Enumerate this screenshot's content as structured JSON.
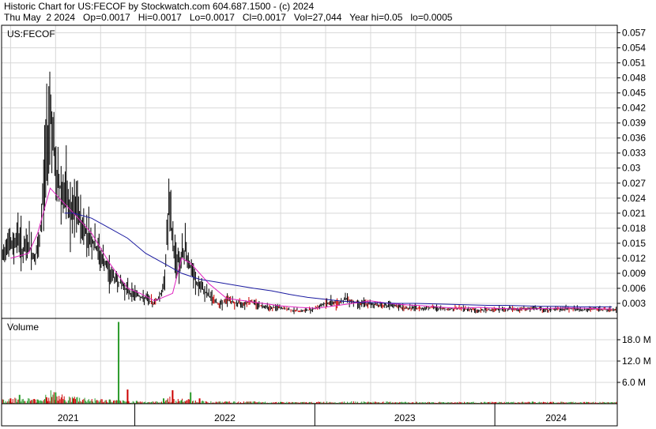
{
  "header": {
    "line1": "Historic Chart for US:FECOF by Stockwatch.com 604.687.1500 - (c) 2024",
    "line2": "Thu May  2 2024   Op=0.0017   Hi=0.0017   Lo=0.0017   Cl=0.0017   Vol=27,044   Year hi=0.05   lo=0.0005"
  },
  "colors": {
    "price": "#000000",
    "down_bar": "#cc0000",
    "ma_fast": "#e020c0",
    "ma_slow": "#1a1aa0",
    "volume_up": "#2a9a2a",
    "volume_down": "#cc0000",
    "grid": "#d8d8d8",
    "frame": "#000000"
  },
  "chart_data": [
    {
      "type": "line",
      "panel": "price",
      "title": "US:FECOF",
      "ylim": [
        0,
        0.0585
      ],
      "y_ticks": [
        "0.057",
        "0.054",
        "0.051",
        "0.048",
        "0.045",
        "0.042",
        "0.039",
        "0.036",
        "0.033",
        "0.03",
        "0.027",
        "0.024",
        "0.021",
        "0.018",
        "0.015",
        "0.012",
        "0.009",
        "0.006",
        "0.003"
      ],
      "x_labels": [
        "2021",
        "2022",
        "2023",
        "2024"
      ],
      "x_range": [
        2020.95,
        2024.37
      ],
      "x_boundaries": [
        2021.69,
        2022.69,
        2023.69
      ],
      "grid": true,
      "series": [
        {
          "role": "price",
          "x": [
            2020.95,
            2020.98,
            2021.01,
            2021.04,
            2021.07,
            2021.1,
            2021.13,
            2021.16,
            2021.19,
            2021.22,
            2021.25,
            2021.28,
            2021.31,
            2021.34,
            2021.37,
            2021.4,
            2021.43,
            2021.46,
            2021.49,
            2021.52,
            2021.55,
            2021.58,
            2021.61,
            2021.64,
            2021.67,
            2021.7,
            2021.73,
            2021.76,
            2021.79,
            2021.82,
            2021.85,
            2021.88,
            2021.91,
            2021.94,
            2021.97,
            2022.0,
            2022.03,
            2022.06,
            2022.09,
            2022.12,
            2022.15,
            2022.18,
            2022.21,
            2022.24,
            2022.27,
            2022.3,
            2022.33,
            2022.36,
            2022.39,
            2022.42,
            2022.45,
            2022.48,
            2022.51,
            2022.54,
            2022.57,
            2022.6,
            2022.63,
            2022.66,
            2022.69,
            2022.72,
            2022.75,
            2022.78,
            2022.81,
            2022.84,
            2022.87,
            2022.9,
            2022.93,
            2022.96,
            2022.99,
            2023.02,
            2023.05,
            2023.08,
            2023.11,
            2023.14,
            2023.17,
            2023.2,
            2023.23,
            2023.26,
            2023.29,
            2023.32,
            2023.35,
            2023.38,
            2023.41,
            2023.44,
            2023.47,
            2023.5,
            2023.53,
            2023.56,
            2023.59,
            2023.62,
            2023.65,
            2023.68,
            2023.71,
            2023.74,
            2023.77,
            2023.8,
            2023.83,
            2023.86,
            2023.89,
            2023.92,
            2023.95,
            2023.98,
            2024.01,
            2024.04,
            2024.07,
            2024.1,
            2024.13,
            2024.16,
            2024.19,
            2024.22,
            2024.25,
            2024.28,
            2024.31,
            2024.34
          ],
          "values": [
            0.011,
            0.016,
            0.014,
            0.017,
            0.013,
            0.015,
            0.012,
            0.014,
            0.03,
            0.044,
            0.028,
            0.026,
            0.024,
            0.02,
            0.022,
            0.018,
            0.017,
            0.015,
            0.013,
            0.011,
            0.009,
            0.008,
            0.007,
            0.006,
            0.005,
            0.005,
            0.004,
            0.004,
            0.003,
            0.004,
            0.006,
            0.022,
            0.013,
            0.011,
            0.014,
            0.01,
            0.007,
            0.006,
            0.005,
            0.004,
            0.003,
            0.003,
            0.004,
            0.003,
            0.003,
            0.003,
            0.0035,
            0.003,
            0.0025,
            0.0025,
            0.002,
            0.0022,
            0.002,
            0.0018,
            0.0016,
            0.0015,
            0.0015,
            0.0017,
            0.002,
            0.0025,
            0.003,
            0.0032,
            0.003,
            0.0035,
            0.004,
            0.0033,
            0.003,
            0.003,
            0.0028,
            0.0028,
            0.0027,
            0.0026,
            0.0025,
            0.0025,
            0.0022,
            0.002,
            0.0021,
            0.002,
            0.002,
            0.0022,
            0.0021,
            0.002,
            0.0019,
            0.0018,
            0.002,
            0.002,
            0.0019,
            0.0018,
            0.0015,
            0.0016,
            0.0017,
            0.0018,
            0.0018,
            0.0017,
            0.0019,
            0.0018,
            0.0018,
            0.0019,
            0.0019,
            0.002,
            0.0018,
            0.0017,
            0.0018,
            0.0019,
            0.0018,
            0.002,
            0.0019,
            0.0018,
            0.0017,
            0.0018,
            0.0019,
            0.0018,
            0.0017,
            0.0017
          ]
        },
        {
          "role": "ma_fast",
          "x": [
            2021.0,
            2021.1,
            2021.15,
            2021.22,
            2021.27,
            2021.35,
            2021.45,
            2021.55,
            2021.65,
            2021.72,
            2021.8,
            2021.9,
            2021.95,
            2022.0,
            2022.1,
            2022.2,
            2022.3,
            2022.4,
            2022.5,
            2022.6,
            2022.7,
            2022.8,
            2022.9,
            2023.0,
            2023.1,
            2023.2,
            2023.3,
            2023.4,
            2023.5,
            2023.6,
            2023.7,
            2023.8,
            2023.9,
            2024.0,
            2024.1,
            2024.2,
            2024.3,
            2024.34
          ],
          "values": [
            0.012,
            0.013,
            0.017,
            0.026,
            0.024,
            0.021,
            0.017,
            0.011,
            0.006,
            0.005,
            0.0035,
            0.005,
            0.012,
            0.011,
            0.007,
            0.004,
            0.0035,
            0.003,
            0.0025,
            0.0022,
            0.002,
            0.0025,
            0.003,
            0.0035,
            0.003,
            0.0027,
            0.0025,
            0.0022,
            0.002,
            0.0022,
            0.002,
            0.0019,
            0.0019,
            0.002,
            0.0021,
            0.002,
            0.0019,
            0.0019
          ]
        },
        {
          "role": "ma_slow",
          "x": [
            2021.3,
            2021.35,
            2021.45,
            2021.55,
            2021.65,
            2021.75,
            2021.85,
            2021.95,
            2022.05,
            2022.15,
            2022.25,
            2022.35,
            2022.45,
            2022.55,
            2022.65,
            2022.75,
            2022.85,
            2022.95,
            2023.05,
            2023.15,
            2023.25,
            2023.35,
            2023.45,
            2023.55,
            2023.65,
            2023.75,
            2023.85,
            2023.95,
            2024.05,
            2024.15,
            2024.25,
            2024.34
          ],
          "values": [
            0.021,
            0.021,
            0.02,
            0.018,
            0.016,
            0.013,
            0.011,
            0.009,
            0.0078,
            0.0072,
            0.0066,
            0.006,
            0.0055,
            0.0048,
            0.0042,
            0.0038,
            0.0034,
            0.0032,
            0.0031,
            0.003,
            0.003,
            0.0029,
            0.0028,
            0.0027,
            0.0026,
            0.0026,
            0.0025,
            0.0024,
            0.0024,
            0.0023,
            0.0023,
            0.0023
          ]
        }
      ]
    },
    {
      "type": "bar",
      "panel": "volume",
      "title": "Volume",
      "ylim": [
        0,
        24000000
      ],
      "y_ticks": [
        "18.0 M",
        "12.0 M",
        "6.0 M"
      ],
      "x_range": [
        2020.95,
        2024.37
      ],
      "grid": true,
      "series": [
        {
          "role": "volume_spikes",
          "x": [
            2021.0,
            2021.05,
            2021.15,
            2021.2,
            2021.25,
            2021.3,
            2021.35,
            2021.55,
            2021.6,
            2021.65,
            2021.7,
            2021.85,
            2021.9,
            2021.95,
            2022.0,
            2022.05,
            2022.2,
            2022.5,
            2023.0,
            2023.55,
            2023.9,
            2024.0,
            2024.2,
            2024.3
          ],
          "values": [
            1500000,
            2500000,
            1200000,
            1800000,
            3200000,
            1000000,
            1500000,
            1200000,
            23000000,
            4000000,
            800000,
            1500000,
            3800000,
            1000000,
            3200000,
            1500000,
            600000,
            500000,
            300000,
            300000,
            600000,
            500000,
            400000,
            300000
          ]
        }
      ]
    }
  ]
}
